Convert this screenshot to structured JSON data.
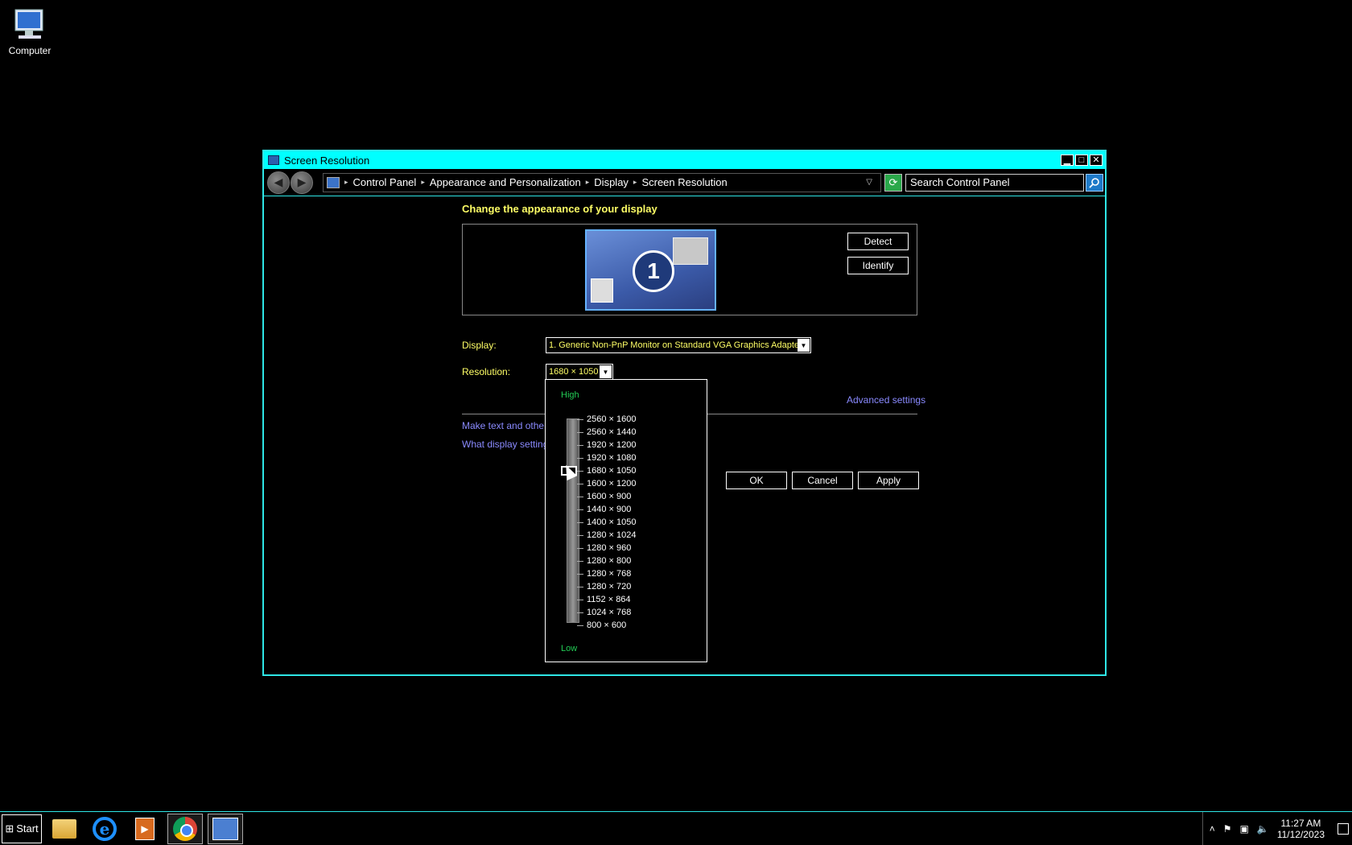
{
  "desktop": {
    "icon_label": "Computer"
  },
  "window": {
    "title": "Screen Resolution",
    "controls": {
      "minimize": "▁",
      "maximize": "□",
      "close": "✕"
    }
  },
  "nav": {
    "breadcrumbs": [
      "Control Panel",
      "Appearance and Personalization",
      "Display",
      "Screen Resolution"
    ],
    "search_placeholder": "Search Control Panel"
  },
  "main": {
    "heading": "Change the appearance of your display",
    "monitor_number": "1",
    "detect_label": "Detect",
    "identify_label": "Identify",
    "display_label": "Display:",
    "display_value": "1. Generic Non-PnP Monitor on Standard VGA Graphics Adapter",
    "resolution_label": "Resolution:",
    "resolution_value": "1680 × 1050",
    "advanced_link": "Advanced settings",
    "link_text_size": "Make text and other it",
    "link_display_settings": "What display settings",
    "ok_label": "OK",
    "cancel_label": "Cancel",
    "apply_label": "Apply"
  },
  "resolution_dropdown": {
    "high_label": "High",
    "low_label": "Low",
    "options": [
      "2560 × 1600",
      "2560 × 1440",
      "1920 × 1200",
      "1920 × 1080",
      "1680 × 1050",
      "1600 × 1200",
      "1600 × 900",
      "1440 × 900",
      "1400 × 1050",
      "1280 × 1024",
      "1280 × 960",
      "1280 × 800",
      "1280 × 768",
      "1280 × 720",
      "1152 × 864",
      "1024 × 768",
      "800 × 600"
    ],
    "selected": "1680 × 1050"
  },
  "taskbar": {
    "start_label": "Start",
    "time": "11:27 AM",
    "date": "11/12/2023"
  },
  "colors": {
    "window_border": "#00ffff",
    "label_yellow": "#ffff66",
    "link_blue": "#8a8aff",
    "slider_green": "#22cc55"
  }
}
